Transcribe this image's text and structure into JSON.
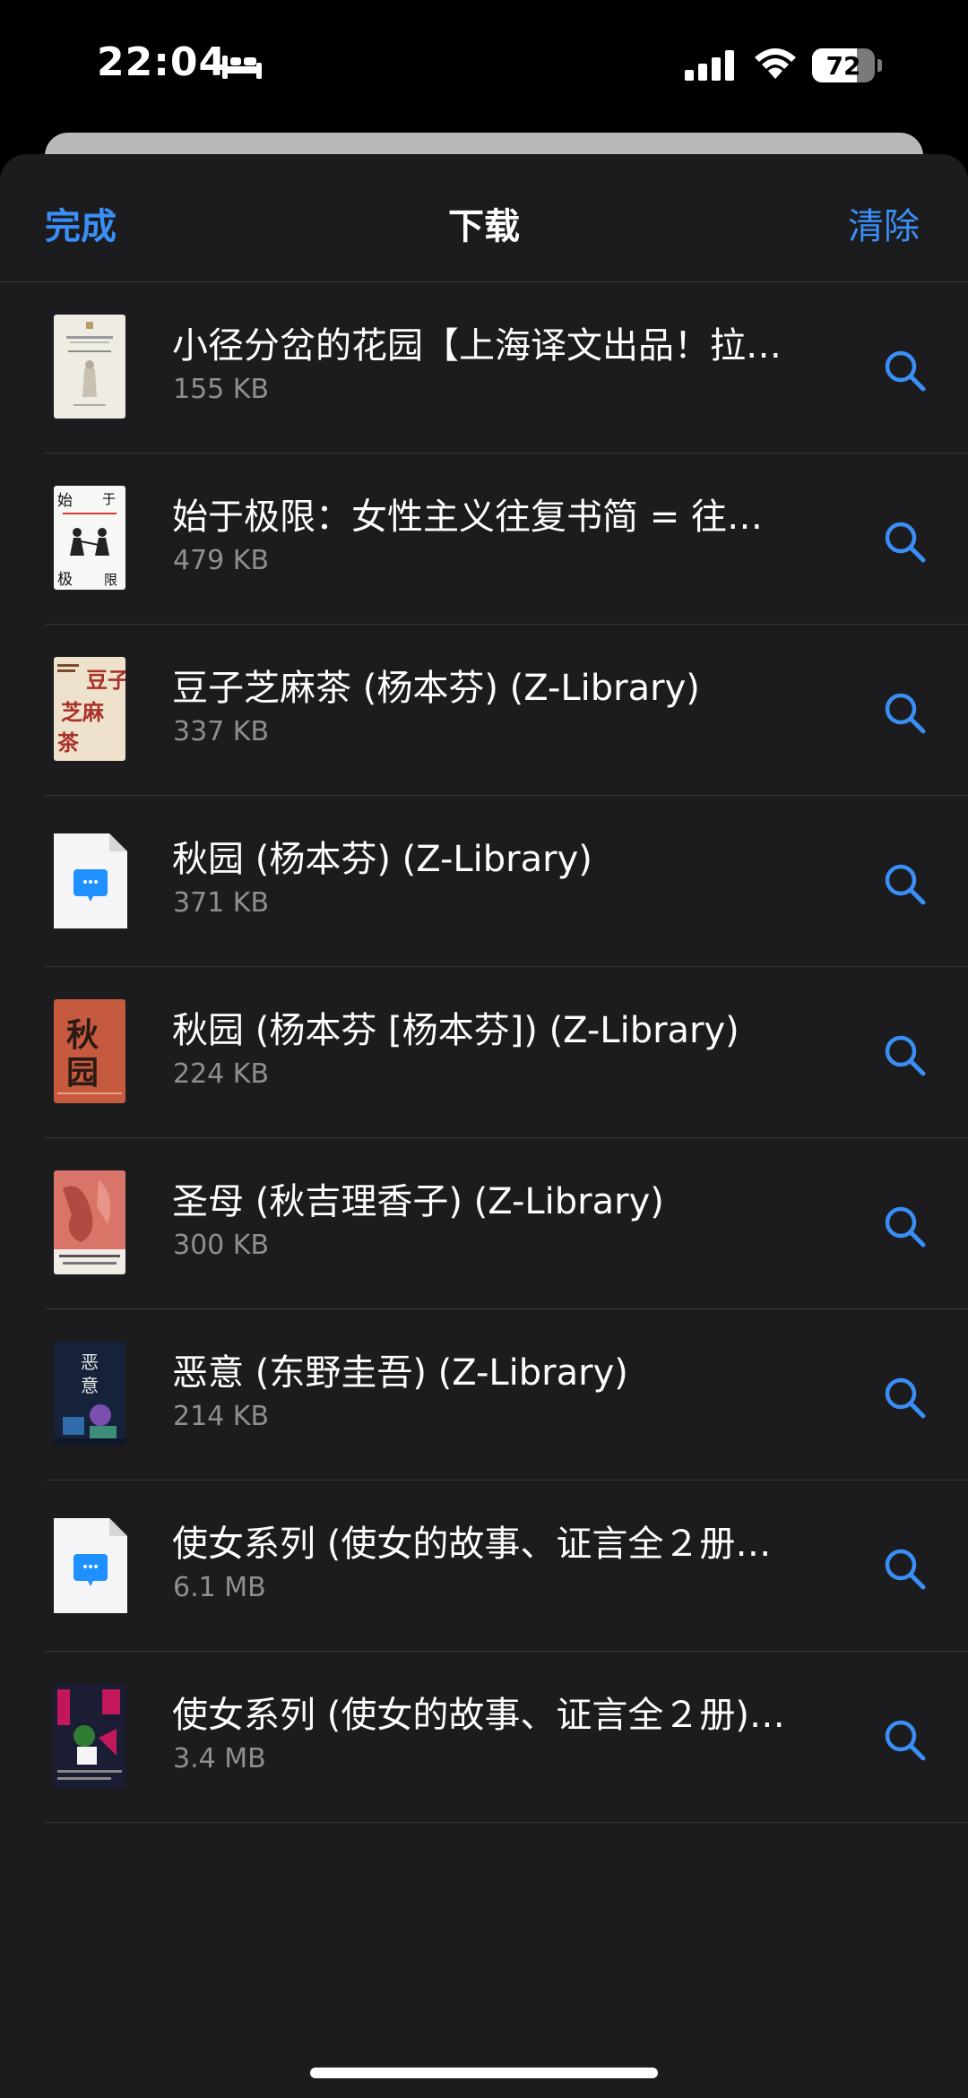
{
  "status_bar": {
    "time": "22:04",
    "battery_level": "72",
    "icons": [
      "bed-icon",
      "cellular-signal-icon",
      "wifi-icon",
      "battery-icon"
    ]
  },
  "nav": {
    "done_label": "完成",
    "title": "下载",
    "clear_label": "清除"
  },
  "downloads": [
    {
      "title": "小径分岔的花园【上海译文出品！拉…",
      "size": "155 KB",
      "cover": "cover-a"
    },
    {
      "title": "始于极限：女性主义往复书简 = 往…",
      "size": "479 KB",
      "cover": "cover-b",
      "cover_text": [
        "始",
        "于",
        "极",
        "限"
      ]
    },
    {
      "title": "豆子芝麻茶 (杨本芬) (Z-Library)",
      "size": "337 KB",
      "cover": "cover-c",
      "cover_text": [
        "豆子",
        "芝麻",
        "茶"
      ]
    },
    {
      "title": "秋园 (杨本芬) (Z-Library)",
      "size": "371 KB",
      "cover": "doc-icon"
    },
    {
      "title": "秋园 (杨本芬 [杨本芬]) (Z-Library)",
      "size": "224 KB",
      "cover": "cover-e",
      "cover_text": [
        "秋",
        "园"
      ]
    },
    {
      "title": "圣母 (秋吉理香子) (Z-Library)",
      "size": "300 KB",
      "cover": "cover-f"
    },
    {
      "title": "恶意 (东野圭吾) (Z-Library)",
      "size": "214 KB",
      "cover": "cover-g",
      "cover_text": [
        "恶",
        "意"
      ]
    },
    {
      "title": "使女系列 (使女的故事、证言全２册…",
      "size": "6.1 MB",
      "cover": "doc-icon"
    },
    {
      "title": "使女系列 (使女的故事、证言全２册)…",
      "size": "3.4 MB",
      "cover": "cover-i"
    }
  ],
  "colors": {
    "accent": "#3a8ff7",
    "background": "#1c1c1e",
    "secondary_text": "#8e8e93",
    "separator": "#38383a"
  }
}
